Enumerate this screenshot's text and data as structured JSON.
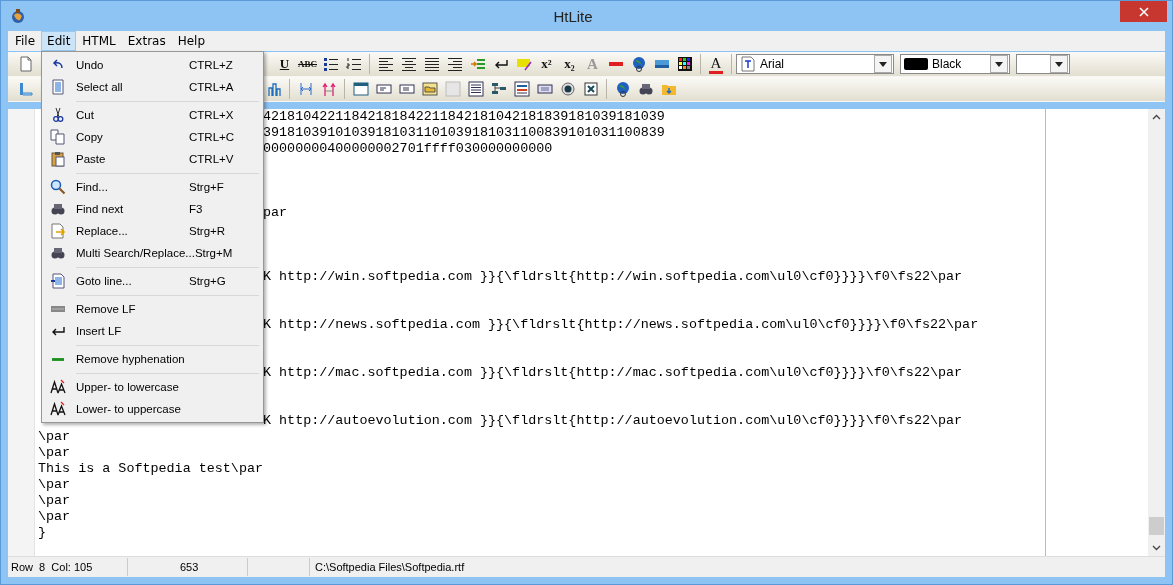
{
  "window": {
    "title": "HtLite"
  },
  "menu_bar": [
    {
      "label": "File",
      "selected": false
    },
    {
      "label": "Edit",
      "selected": true
    },
    {
      "label": "HTML",
      "selected": false
    },
    {
      "label": "Extras",
      "selected": false
    },
    {
      "label": "Help",
      "selected": false
    }
  ],
  "toolbar_1": [
    {
      "kind": "icon"
    },
    {
      "kind": "gap"
    },
    {
      "kind": "glyph",
      "label": "U"
    },
    {
      "kind": "glyph",
      "label": "ABC"
    },
    {
      "kind": "icon"
    },
    {
      "kind": "icon"
    },
    {
      "kind": "separator"
    },
    {
      "kind": "icon"
    },
    {
      "kind": "icon"
    },
    {
      "kind": "icon"
    },
    {
      "kind": "icon"
    },
    {
      "kind": "icon"
    },
    {
      "kind": "icon"
    },
    {
      "kind": "icon"
    },
    {
      "kind": "glyph",
      "label": "x²"
    },
    {
      "kind": "glyph",
      "label": "x₂"
    },
    {
      "kind": "glyph",
      "label": "A"
    },
    {
      "kind": "icon"
    },
    {
      "kind": "icon"
    },
    {
      "kind": "icon"
    },
    {
      "kind": "icon"
    },
    {
      "kind": "separator"
    },
    {
      "kind": "glyph",
      "label": "A"
    },
    {
      "kind": "separator"
    },
    {
      "kind": "combo",
      "value": "Arial"
    },
    {
      "kind": "combo",
      "value": "Black"
    },
    {
      "kind": "combo"
    }
  ],
  "toolbar_2": [
    {
      "kind": "icon"
    },
    {
      "kind": "gap"
    },
    {
      "kind": "icon"
    },
    {
      "kind": "separator"
    },
    {
      "kind": "icon"
    },
    {
      "kind": "icon"
    },
    {
      "kind": "separator"
    },
    {
      "kind": "icon"
    },
    {
      "kind": "icon"
    },
    {
      "kind": "icon"
    },
    {
      "kind": "icon"
    },
    {
      "kind": "icon"
    },
    {
      "kind": "icon"
    },
    {
      "kind": "icon"
    },
    {
      "kind": "icon"
    },
    {
      "kind": "icon"
    },
    {
      "kind": "icon"
    },
    {
      "kind": "icon"
    },
    {
      "kind": "separator"
    },
    {
      "kind": "icon"
    },
    {
      "kind": "icon"
    },
    {
      "kind": "icon"
    }
  ],
  "edit_menu": [
    {
      "kind": "item",
      "label": "Undo",
      "shortcut": "CTRL+Z"
    },
    {
      "kind": "item",
      "label": "Select all",
      "shortcut": "CTRL+A"
    },
    {
      "kind": "separator"
    },
    {
      "kind": "item",
      "label": "Cut",
      "shortcut": "CTRL+X"
    },
    {
      "kind": "item",
      "label": "Copy",
      "shortcut": "CTRL+C"
    },
    {
      "kind": "item",
      "label": "Paste",
      "shortcut": "CTRL+V"
    },
    {
      "kind": "separator"
    },
    {
      "kind": "item",
      "label": "Find...",
      "shortcut": "Strg+F"
    },
    {
      "kind": "item",
      "label": "Find next",
      "shortcut": "F3"
    },
    {
      "kind": "item",
      "label": "Replace...",
      "shortcut": "Strg+R"
    },
    {
      "kind": "item",
      "label": "Multi Search/Replace...",
      "shortcut": "Strg+M"
    },
    {
      "kind": "separator"
    },
    {
      "kind": "item",
      "label": "Goto line...",
      "shortcut": "Strg+G"
    },
    {
      "kind": "separator"
    },
    {
      "kind": "item",
      "label": "Remove LF"
    },
    {
      "kind": "item",
      "label": "Insert LF"
    },
    {
      "kind": "separator"
    },
    {
      "kind": "item",
      "label": "Remove hyphenation"
    },
    {
      "kind": "separator"
    },
    {
      "kind": "item",
      "label": "Upper- to lowercase"
    },
    {
      "kind": "item",
      "label": "Lower- to uppercase"
    }
  ],
  "editor": {
    "lines": [
      {
        "kind": "offset",
        "text": "42181042211842181842211842181042181839181039181039"
      },
      {
        "kind": "offset",
        "text": "39181039101039181031101039181031100839101031100839"
      },
      {
        "kind": "offset",
        "text": "00000000400000002701ffff030000000000"
      },
      {
        "kind": "blank"
      },
      {
        "kind": "blank"
      },
      {
        "kind": "blank"
      },
      {
        "kind": "offset",
        "text": "par"
      },
      {
        "kind": "blank"
      },
      {
        "kind": "blank"
      },
      {
        "kind": "blank"
      },
      {
        "kind": "offset",
        "text": "K http://win.softpedia.com }}{\\fldrslt{http://win.softpedia.com\\ul0\\cf0}}}}\\f0\\fs22\\par"
      },
      {
        "kind": "blank"
      },
      {
        "kind": "blank"
      },
      {
        "kind": "offset",
        "text": "K http://news.softpedia.com }}{\\fldrslt{http://news.softpedia.com\\ul0\\cf0}}}}\\f0\\fs22\\par"
      },
      {
        "kind": "blank"
      },
      {
        "kind": "blank"
      },
      {
        "kind": "offset",
        "text": "K http://mac.softpedia.com }}{\\fldrslt{http://mac.softpedia.com\\ul0\\cf0}}}}\\f0\\fs22\\par"
      },
      {
        "kind": "blank"
      },
      {
        "kind": "blank"
      },
      {
        "kind": "offset",
        "text": "K http://autoevolution.com }}{\\fldrslt{http://autoevolution.com\\ul0\\cf0}}}}\\f0\\fs22\\par"
      },
      {
        "kind": "text",
        "text": "\\par"
      },
      {
        "kind": "text",
        "text": "\\par"
      },
      {
        "kind": "text",
        "text": "This is a Softpedia test\\par"
      },
      {
        "kind": "text",
        "text": "\\par"
      },
      {
        "kind": "text",
        "text": "\\par"
      },
      {
        "kind": "text",
        "text": "\\par"
      },
      {
        "kind": "text",
        "text": "}"
      }
    ]
  },
  "status_bar": {
    "row": "Row  8  Col: 105",
    "count": "653",
    "path": "C:\\Softpedia Files\\Softpedia.rtf"
  }
}
